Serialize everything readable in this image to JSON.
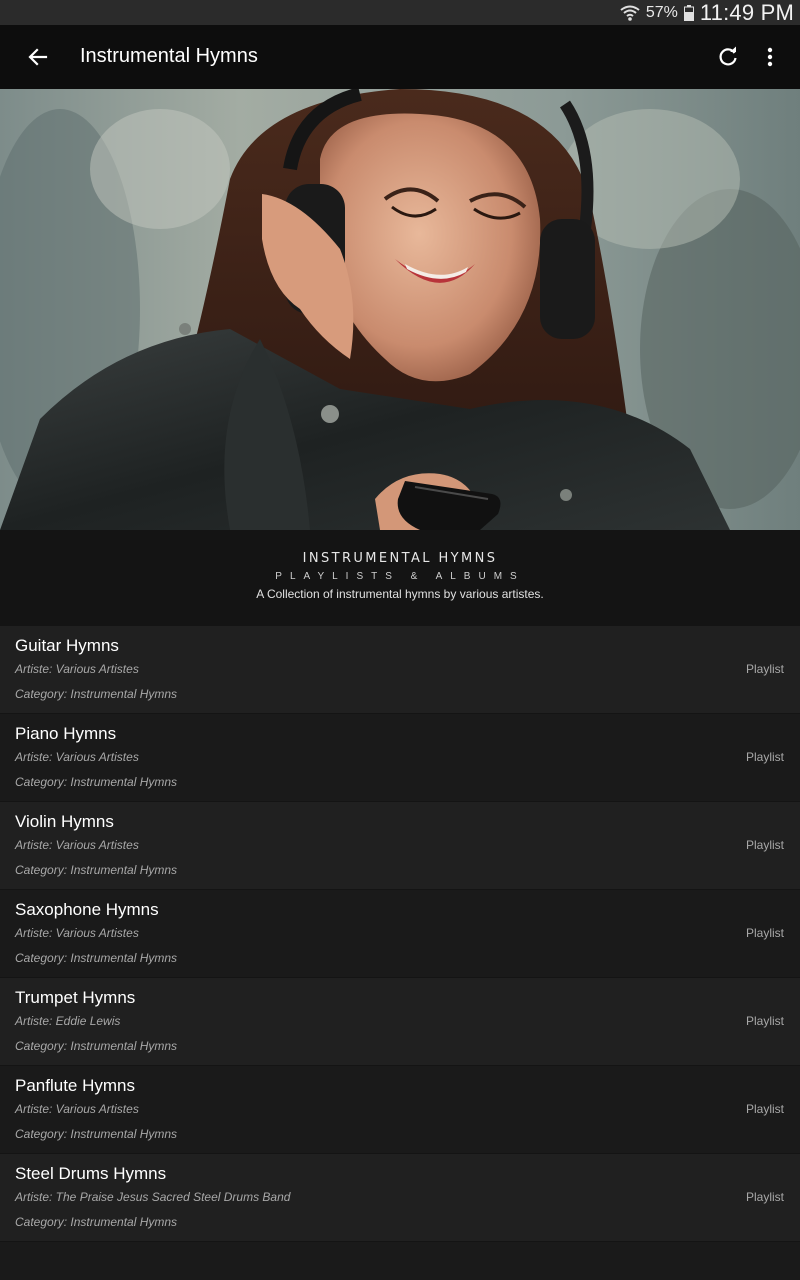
{
  "status_bar": {
    "battery_percent": "57%",
    "time": "11:49 PM"
  },
  "app_bar": {
    "title": "Instrumental Hymns",
    "icons": [
      "back-arrow-icon",
      "refresh-icon",
      "more-vert-icon"
    ]
  },
  "hero": {
    "image": "woman-listening-headphones"
  },
  "header": {
    "title": "INSTRUMENTAL HYMNS",
    "subtitle": "PLAYLISTS & ALBUMS",
    "description": "A Collection of instrumental hymns by various artistes."
  },
  "items": [
    {
      "title": "Guitar Hymns",
      "artist": "Artiste: Various Artistes",
      "category": "Category: Instrumental Hymns",
      "type": "Playlist"
    },
    {
      "title": "Piano Hymns",
      "artist": "Artiste: Various Artistes",
      "category": "Category: Instrumental Hymns",
      "type": "Playlist"
    },
    {
      "title": "Violin Hymns",
      "artist": "Artiste: Various Artistes",
      "category": "Category: Instrumental Hymns",
      "type": "Playlist"
    },
    {
      "title": "Saxophone Hymns",
      "artist": "Artiste: Various Artistes",
      "category": "Category: Instrumental Hymns",
      "type": "Playlist"
    },
    {
      "title": "Trumpet Hymns",
      "artist": "Artiste: Eddie Lewis",
      "category": "Category: Instrumental Hymns",
      "type": "Playlist"
    },
    {
      "title": "Panflute Hymns",
      "artist": "Artiste: Various Artistes",
      "category": "Category: Instrumental Hymns",
      "type": "Playlist"
    },
    {
      "title": "Steel Drums Hymns",
      "artist": "Artiste: The Praise Jesus Sacred Steel Drums Band",
      "category": "Category: Instrumental Hymns",
      "type": "Playlist"
    }
  ]
}
